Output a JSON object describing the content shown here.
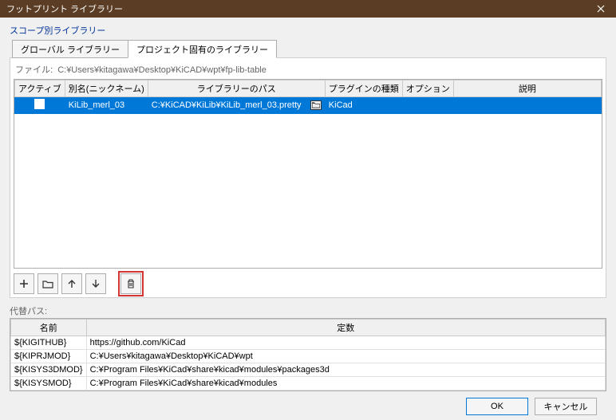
{
  "title": "フットプリント ライブラリー",
  "scope_label": "スコープ別ライブラリー",
  "tabs": {
    "global": "グローバル ライブラリー",
    "project": "プロジェクト固有のライブラリー"
  },
  "file_prefix": "ファイル:",
  "file_path": "C:¥Users¥kitagawa¥Desktop¥KiCAD¥wpt¥fp-lib-table",
  "cols": {
    "active": "アクティブ",
    "nick": "別名(ニックネーム)",
    "path": "ライブラリーのパス",
    "plugin": "プラグインの種類",
    "opt": "オプション",
    "desc": "説明"
  },
  "rows": [
    {
      "active": true,
      "nick": "KiLib_merl_03",
      "path": "C:¥KiCAD¥KiLib¥KiLib_merl_03.pretty",
      "plugin": "KiCad",
      "opt": "",
      "desc": ""
    }
  ],
  "subs_label": "代替パス:",
  "subs_cols": {
    "name": "名前",
    "const": "定数"
  },
  "subs_rows": [
    {
      "name": "${KIGITHUB}",
      "val": "https://github.com/KiCad"
    },
    {
      "name": "${KIPRJMOD}",
      "val": "C:¥Users¥kitagawa¥Desktop¥KiCAD¥wpt"
    },
    {
      "name": "${KISYS3DMOD}",
      "val": "C:¥Program Files¥KiCad¥share¥kicad¥modules¥packages3d"
    },
    {
      "name": "${KISYSMOD}",
      "val": "C:¥Program Files¥KiCad¥share¥kicad¥modules"
    }
  ],
  "buttons": {
    "ok": "OK",
    "cancel": "キャンセル"
  }
}
